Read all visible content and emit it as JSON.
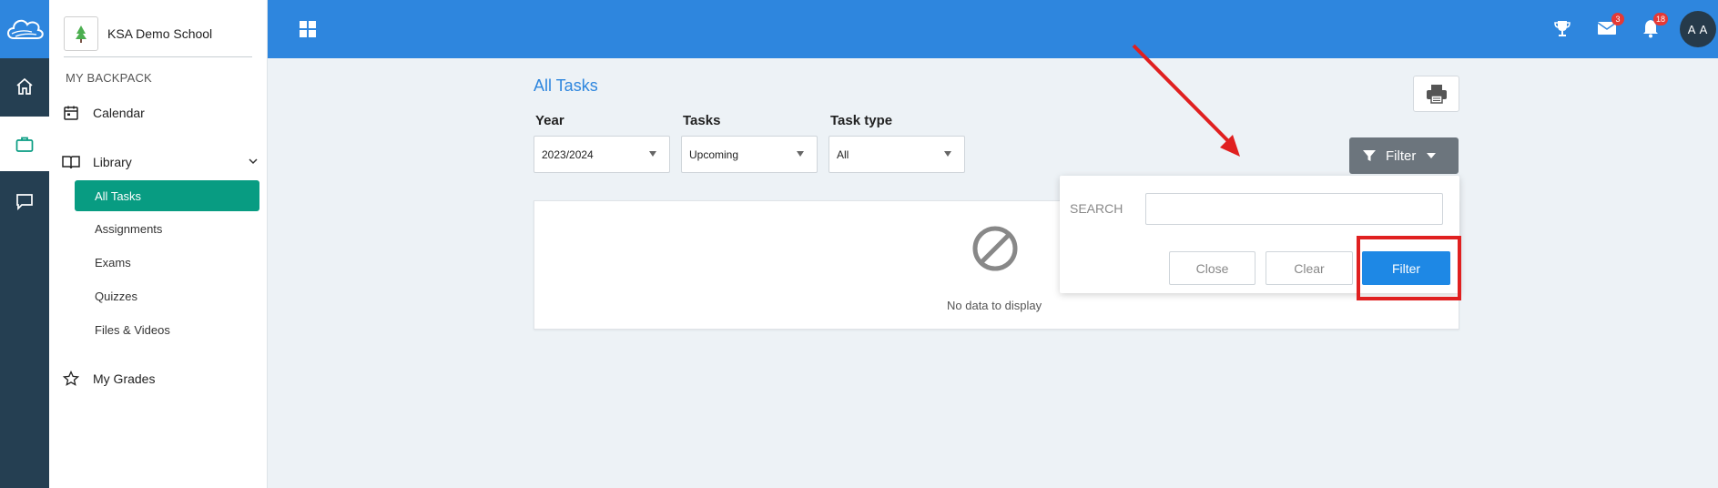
{
  "app": {
    "school_name": "KSA Demo School",
    "logo_icon": "cloud-icon",
    "brand_color": "#2e86de",
    "accent_color": "#089c82"
  },
  "rail": [
    {
      "name": "home",
      "icon": "home-icon"
    },
    {
      "name": "backpack",
      "icon": "briefcase-icon",
      "active": true
    },
    {
      "name": "messages",
      "icon": "chat-icon"
    }
  ],
  "sidebar": {
    "section_title": "MY BACKPACK",
    "calendar": "Calendar",
    "library": "Library",
    "library_items": [
      "All Tasks",
      "Assignments",
      "Exams",
      "Quizzes",
      "Files & Videos"
    ],
    "active_item": "All Tasks",
    "grades": "My Grades"
  },
  "topbar": {
    "trophy_icon": "trophy-icon",
    "mail_badge": "3",
    "notifications_badge": "18",
    "avatar_initials": "A A"
  },
  "main": {
    "title": "All Tasks",
    "filters": {
      "year_label": "Year",
      "year_value": "2023/2024",
      "tasks_label": "Tasks",
      "tasks_value": "Upcoming",
      "type_label": "Task type",
      "type_value": "All"
    },
    "filter_toggle_label": "Filter",
    "empty_text": "No data to display"
  },
  "filter_dropdown": {
    "search_label": "SEARCH",
    "search_value": "",
    "close_label": "Close",
    "clear_label": "Clear",
    "filter_label": "Filter"
  }
}
